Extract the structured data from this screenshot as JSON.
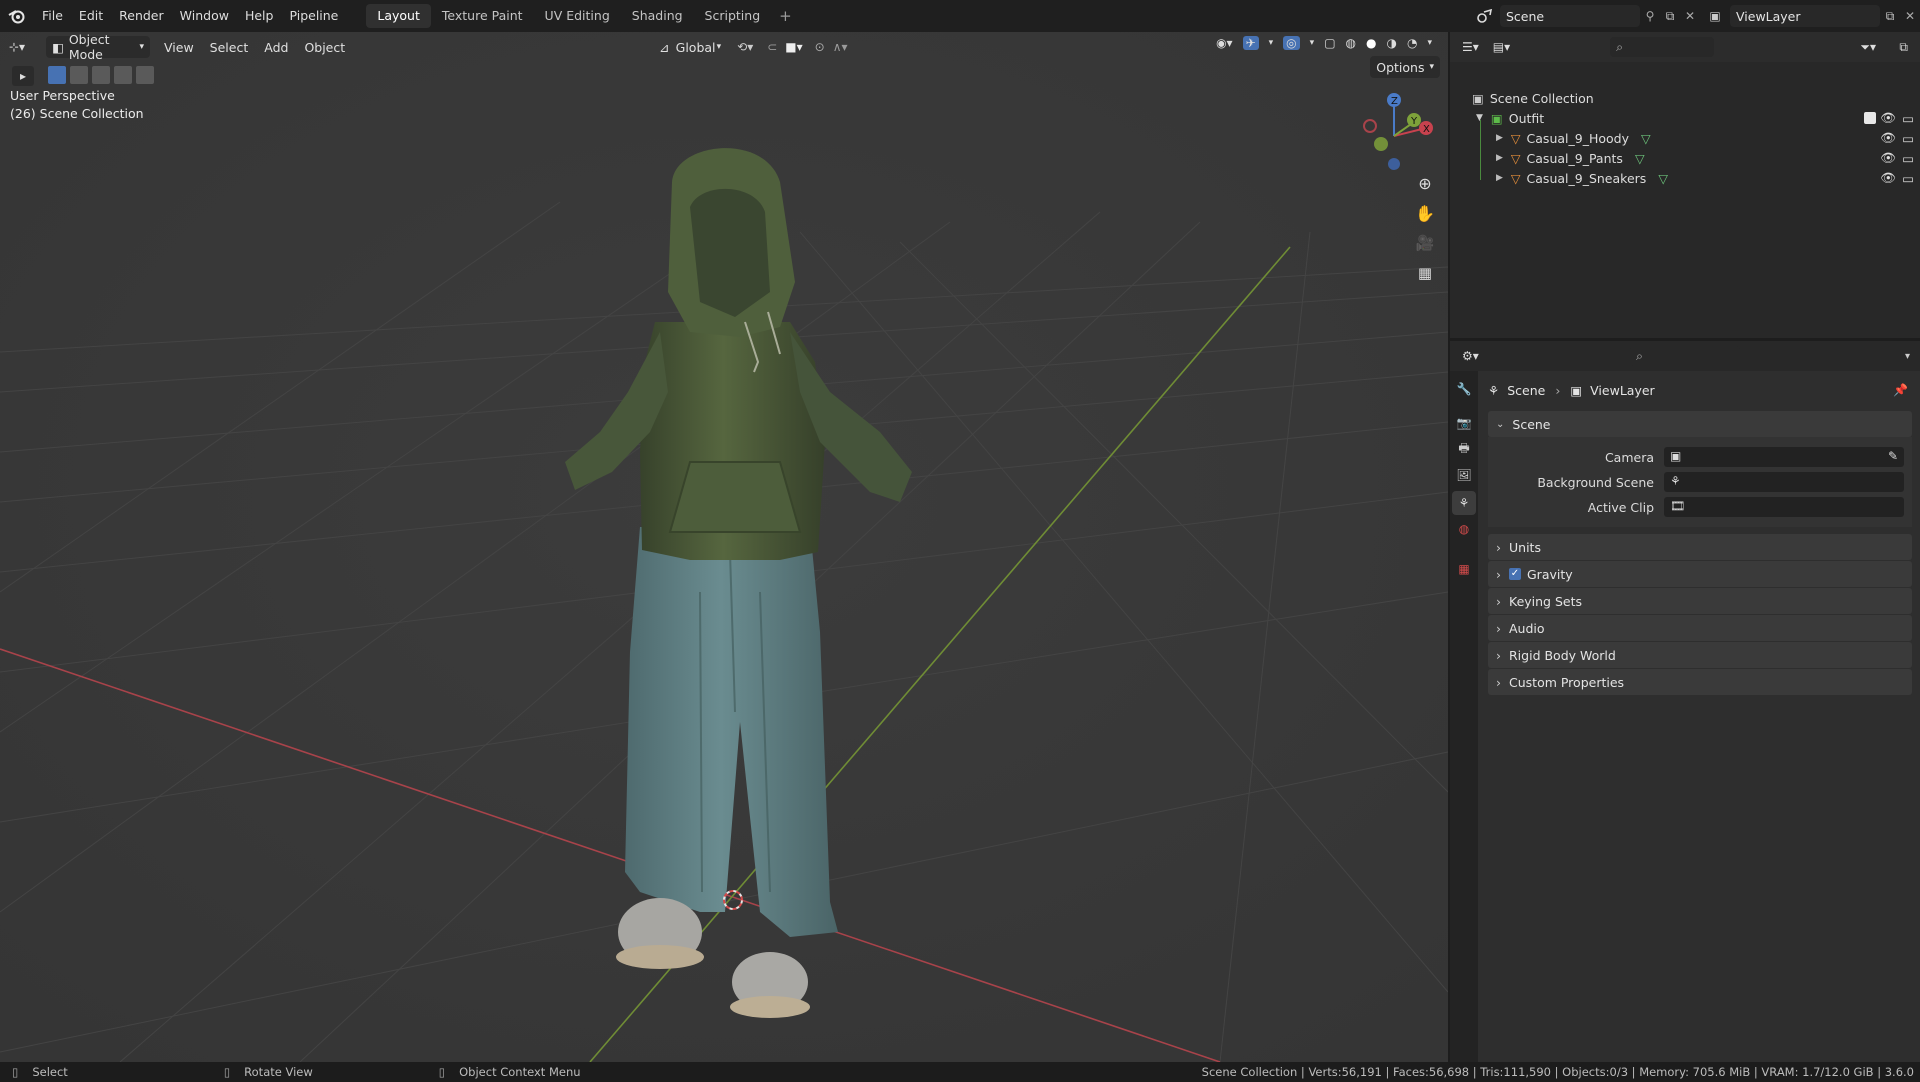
{
  "menubar": {
    "items": [
      "File",
      "Edit",
      "Render",
      "Window",
      "Help",
      "Pipeline"
    ],
    "workspaces": [
      "Layout",
      "Texture Paint",
      "UV Editing",
      "Shading",
      "Scripting"
    ],
    "active_workspace": "Layout",
    "scene_name": "Scene",
    "view_layer": "ViewLayer"
  },
  "viewport": {
    "mode": "Object Mode",
    "menus": [
      "View",
      "Select",
      "Add",
      "Object"
    ],
    "orientation": "Global",
    "options_label": "Options",
    "view_name": "User Perspective",
    "collection_info": "(26) Scene Collection",
    "gizmo_axes": {
      "x": "X",
      "y": "Y",
      "z": "Z"
    },
    "colors": {
      "axis_x": "#a8434a",
      "axis_y": "#6f8c35",
      "hoody": "#49573a",
      "pants": "#5f7f82",
      "grid": "#444444"
    }
  },
  "outliner": {
    "root": "Scene Collection",
    "collection": "Outfit",
    "objects": [
      {
        "name": "Casual_9_Hoody"
      },
      {
        "name": "Casual_9_Pants"
      },
      {
        "name": "Casual_9_Sneakers"
      }
    ]
  },
  "properties": {
    "breadcrumb": [
      "Scene",
      "ViewLayer"
    ],
    "panel": "Scene",
    "fields": [
      {
        "label": "Camera"
      },
      {
        "label": "Background Scene"
      },
      {
        "label": "Active Clip"
      }
    ],
    "subpanels": [
      {
        "label": "Units",
        "checkbox": false
      },
      {
        "label": "Gravity",
        "checkbox": true,
        "checked": true
      },
      {
        "label": "Keying Sets",
        "checkbox": false
      },
      {
        "label": "Audio",
        "checkbox": false
      },
      {
        "label": "Rigid Body World",
        "checkbox": false
      },
      {
        "label": "Custom Properties",
        "checkbox": false
      }
    ]
  },
  "statusbar": {
    "select": "Select",
    "rotate": "Rotate View",
    "context": "Object Context Menu",
    "stats": "Scene Collection | Verts:56,191 | Faces:56,698 | Tris:111,590 | Objects:0/3 | Memory: 705.6 MiB | VRAM: 1.7/12.0 GiB | 3.6.0"
  }
}
